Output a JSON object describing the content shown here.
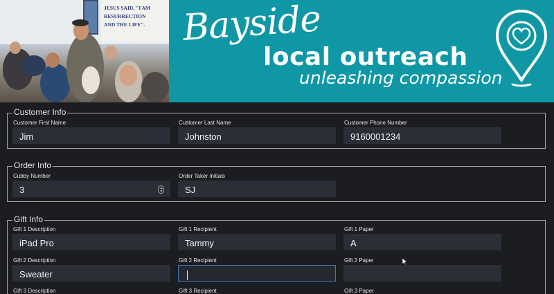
{
  "banner": {
    "sign_text": "JESUS SAID, \"I AM\nRESURRECTION\nAND THE LIFE\".",
    "script_title": "Bayside",
    "main_title": "local outreach",
    "tagline": "unleashing compassion",
    "icon": "heart-location-pin-icon",
    "accent_color": "#0f97a6"
  },
  "customer_info": {
    "legend": "Customer Info",
    "first_name": {
      "label": "Customer First Name",
      "value": "Jim"
    },
    "last_name": {
      "label": "Customer Last Name",
      "value": "Johnston"
    },
    "phone": {
      "label": "Customer Phone Number",
      "value": "9160001234"
    }
  },
  "order_info": {
    "legend": "Order Info",
    "cubby": {
      "label": "Cubby Number",
      "value": "3"
    },
    "initials": {
      "label": "Order Taker Initials",
      "value": "SJ"
    }
  },
  "gift_info": {
    "legend": "Gift Info",
    "gift1": {
      "description": {
        "label": "Gift 1 Description",
        "value": "iPad Pro"
      },
      "recipient": {
        "label": "Gift 1 Recipient",
        "value": "Tammy"
      },
      "paper": {
        "label": "Gift 1 Paper",
        "value": "A"
      }
    },
    "gift2": {
      "description": {
        "label": "Gift 2 Description",
        "value": "Sweater"
      },
      "recipient": {
        "label": "Gift 2 Recipient",
        "value": ""
      },
      "paper": {
        "label": "Gift 2 Paper",
        "value": ""
      }
    },
    "gift3": {
      "description": {
        "label": "Gift 3 Description"
      },
      "recipient": {
        "label": "Gift 3 Recipient"
      },
      "paper": {
        "label": "Gift 3 Paper"
      }
    }
  },
  "colors": {
    "background": "#1c1d21",
    "input_bg": "#2c2e37",
    "focus_border": "#3f78b5"
  }
}
